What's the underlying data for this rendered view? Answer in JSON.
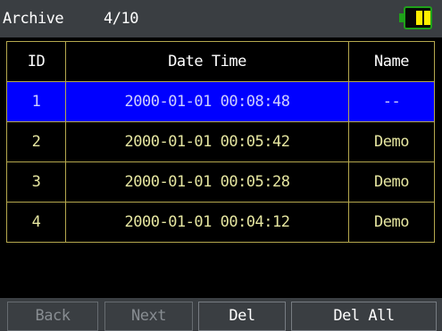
{
  "header": {
    "title": "Archive",
    "page_counter": "4/10",
    "battery_icon": "battery-full-icon",
    "battery_level": 1.0
  },
  "table": {
    "columns": [
      "ID",
      "Date Time",
      "Name"
    ],
    "rows": [
      {
        "id": "1",
        "datetime": "2000-01-01 00:08:48",
        "name": "--",
        "selected": true
      },
      {
        "id": "2",
        "datetime": "2000-01-01 00:05:42",
        "name": "Demo",
        "selected": false
      },
      {
        "id": "3",
        "datetime": "2000-01-01 00:05:28",
        "name": "Demo",
        "selected": false
      },
      {
        "id": "4",
        "datetime": "2000-01-01 00:04:12",
        "name": "Demo",
        "selected": false
      }
    ]
  },
  "footer": {
    "back_label": "Back",
    "next_label": "Next",
    "del_label": "Del",
    "del_all_label": "Del All"
  },
  "colors": {
    "bar_background": "#3a3e42",
    "selection": "#0000ff",
    "table_text": "#e6e6a0",
    "grid_line": "#b5a84e",
    "battery_frame": "#1fa11a",
    "battery_fill": "#ffee00"
  }
}
